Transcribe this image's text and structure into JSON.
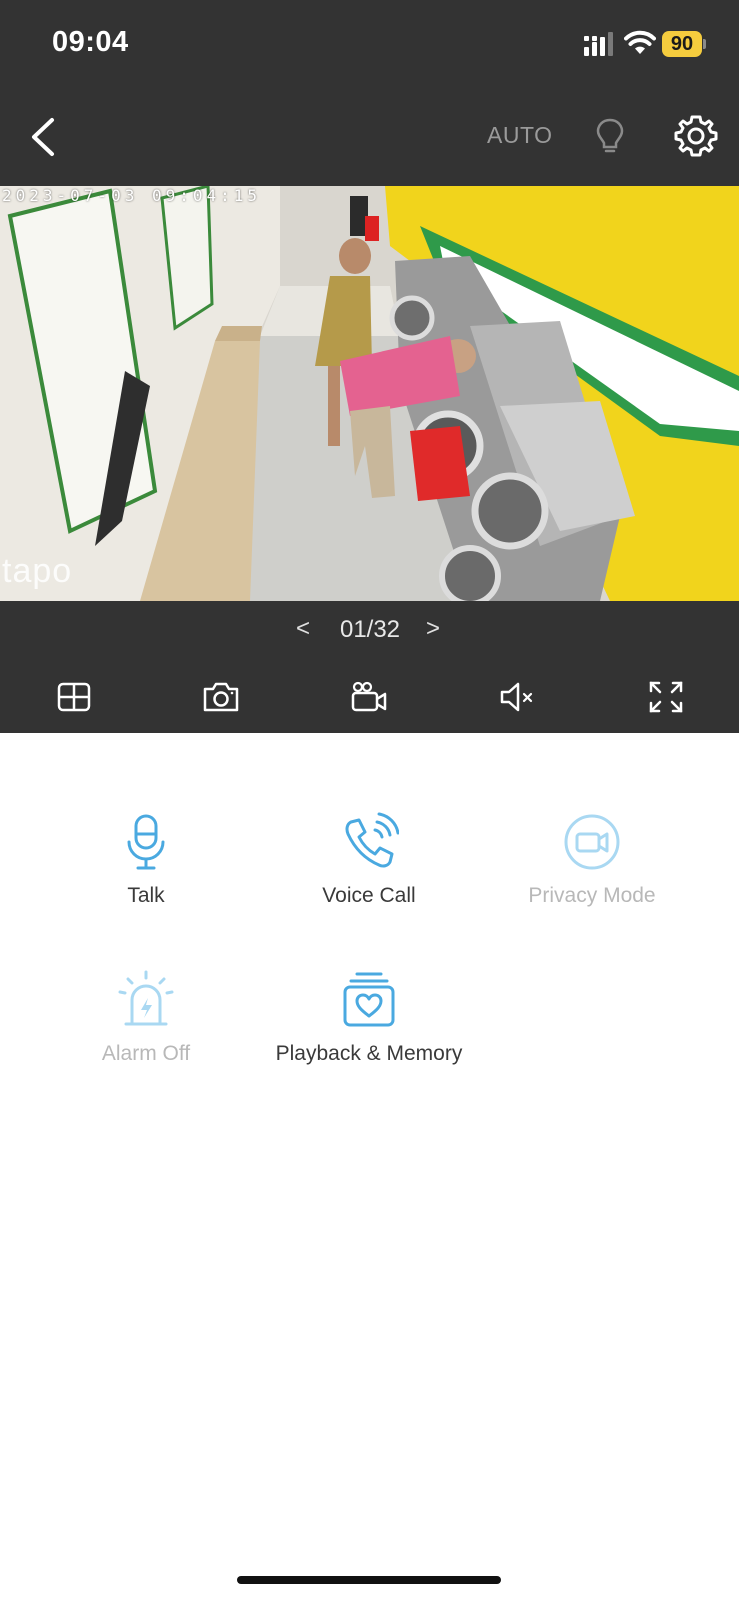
{
  "status_bar": {
    "time": "09:04",
    "battery": "90"
  },
  "nav": {
    "mode_label": "AUTO",
    "icons": [
      "back-icon",
      "bulb-icon",
      "gear-icon"
    ]
  },
  "video": {
    "timestamp": "2023-07-03 09:04:15",
    "watermark": "tapo"
  },
  "pager": {
    "current": "01/32",
    "prev": "<",
    "next": ">"
  },
  "controls": [
    "grid-view-icon",
    "snapshot-icon",
    "record-icon",
    "mute-icon",
    "fullscreen-icon"
  ],
  "actions": [
    {
      "label": "Talk",
      "icon": "microphone-icon",
      "enabled": true
    },
    {
      "label": "Voice Call",
      "icon": "phone-call-icon",
      "enabled": true
    },
    {
      "label": "Privacy Mode",
      "icon": "privacy-camera-icon",
      "enabled": false
    },
    {
      "label": "Alarm Off",
      "icon": "alarm-icon",
      "enabled": false
    },
    {
      "label": "Playback & Memory",
      "icon": "playback-memory-icon",
      "enabled": true
    }
  ],
  "colors": {
    "chrome": "#333333",
    "accent": "#4aa9e0",
    "accent_dim": "#a9d8f2",
    "text_dim": "#b8b8b8"
  }
}
